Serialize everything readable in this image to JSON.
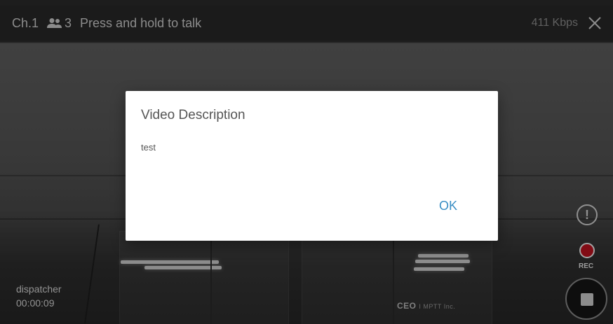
{
  "topbar": {
    "channel": "Ch.1",
    "member_count": "3",
    "ptt_hint": "Press and hold to talk",
    "bitrate": "411 Kbps"
  },
  "dialog": {
    "title": "Video Description",
    "body": "test",
    "ok_label": "OK"
  },
  "stream": {
    "caller": "dispatcher",
    "elapsed": "00:00:09",
    "background_sign": "CEO",
    "background_sign_small": "I MPTT Inc."
  },
  "controls": {
    "rec_label": "REC"
  },
  "colors": {
    "accent": "#3a8ec4",
    "record": "#c0131f"
  },
  "icons": [
    "people-icon",
    "close-icon",
    "alert-icon",
    "record-icon",
    "stop-icon"
  ]
}
